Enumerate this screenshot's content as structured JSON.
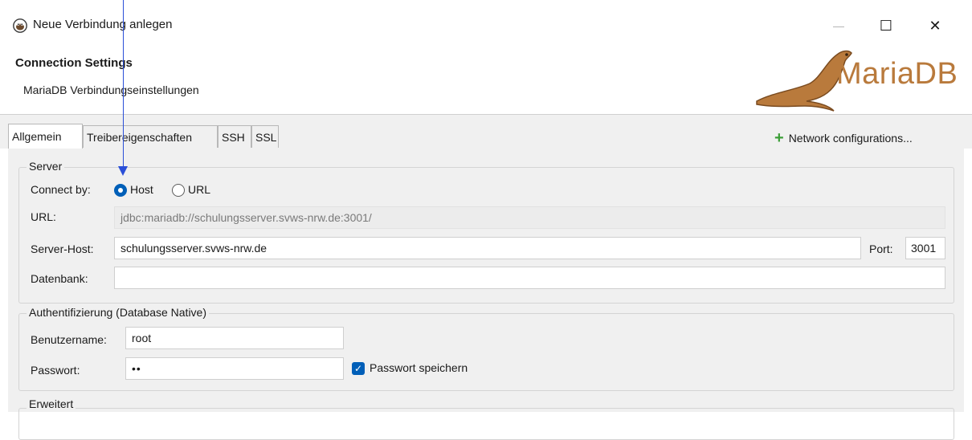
{
  "window": {
    "title": "Neue Verbindung anlegen",
    "minimize": "—",
    "maximize": "☐",
    "close": "✕"
  },
  "header": {
    "title": "Connection Settings",
    "subtitle": "MariaDB Verbindungseinstellungen",
    "logo_text": "MariaDB"
  },
  "tabs": [
    {
      "label": "Allgemein",
      "active": true
    },
    {
      "label": "Treibereigenschaften",
      "active": false
    },
    {
      "label": "SSH",
      "active": false
    },
    {
      "label": "SSL",
      "active": false
    }
  ],
  "network_config": {
    "label": "Network configurations..."
  },
  "server": {
    "group_label": "Server",
    "connect_by_label": "Connect by:",
    "option_host": "Host",
    "option_url": "URL",
    "selected": "Host",
    "url_label": "URL:",
    "url_value": "jdbc:mariadb://schulungsserver.svws-nrw.de:3001/",
    "host_label": "Server-Host:",
    "host_value": "schulungsserver.svws-nrw.de",
    "port_label": "Port:",
    "port_value": "3001",
    "db_label": "Datenbank:",
    "db_value": ""
  },
  "auth": {
    "group_label": "Authentifizierung (Database Native)",
    "user_label": "Benutzername:",
    "user_value": "root",
    "password_label": "Passwort:",
    "password_value": "••",
    "save_password_label": "Passwort speichern",
    "save_password_checked": true
  },
  "advanced": {
    "group_label": "Erweitert"
  },
  "colors": {
    "accent": "#005fb8",
    "annotation_arrow": "#2a4fd8",
    "plus": "#3b9e37"
  }
}
